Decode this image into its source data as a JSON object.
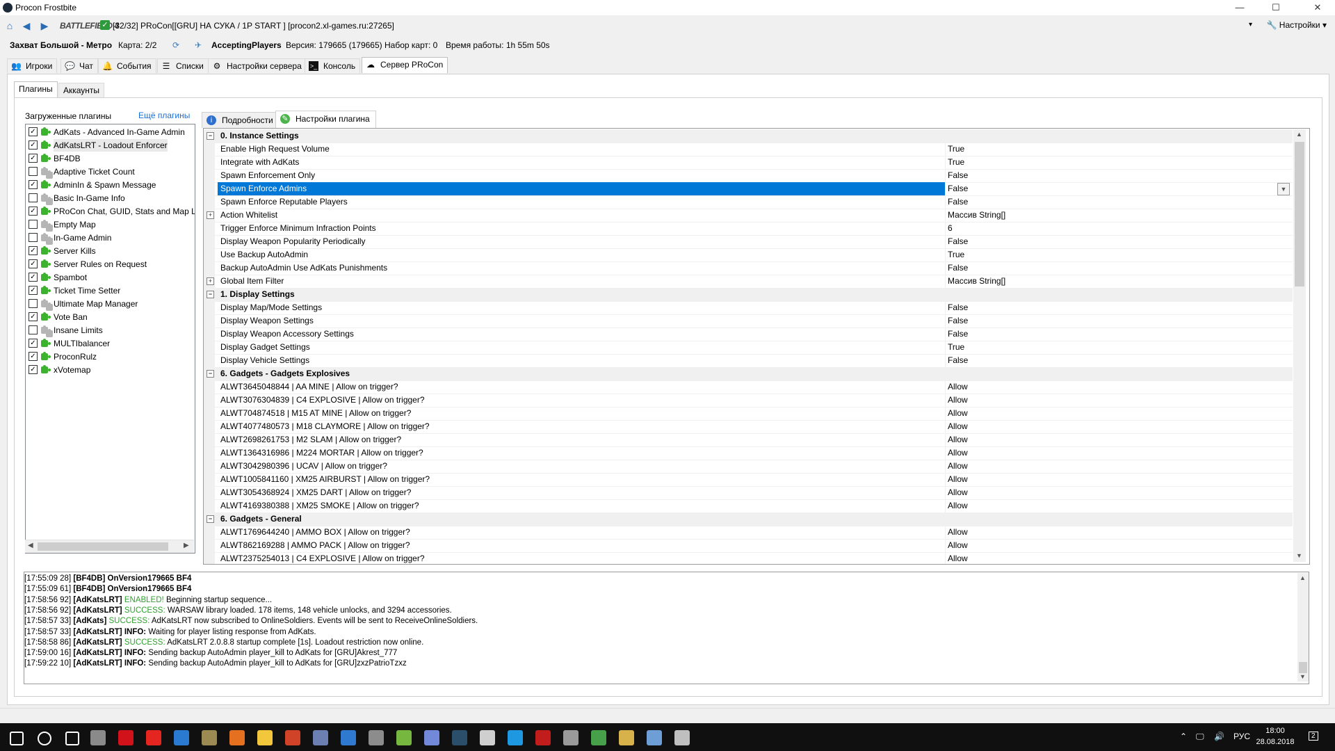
{
  "window": {
    "title": "Procon Frostbite",
    "minimize": "—",
    "maximize": "☐",
    "close": "✕"
  },
  "server": {
    "game": "BATTLEFIELD 4",
    "name": "[32/32] PRoCon[[GRU] НА СУКА / 1P START ] [procon2.xl-games.ru:27265]",
    "settings_label": "Настройки",
    "map": "Захват Большой - Метро",
    "maps": "Карта: 2/2",
    "state": "AcceptingPlayers",
    "version": "Версия: 179665 (179665)",
    "mapset": "Набор карт: 0",
    "uptime": "Время работы: 1h 55m 50s"
  },
  "main_tabs": [
    {
      "label": "Игроки",
      "icon": "players-icon"
    },
    {
      "label": "Чат",
      "icon": "chat-icon"
    },
    {
      "label": "События",
      "icon": "events-icon"
    },
    {
      "label": "Списки",
      "icon": "lists-icon"
    },
    {
      "label": "Настройки сервера",
      "icon": "server-settings-icon"
    },
    {
      "label": "Консоль",
      "icon": "console-icon"
    },
    {
      "label": "Сервер PRoCon",
      "icon": "procon-server-icon"
    }
  ],
  "sub_tabs": [
    {
      "label": "Плагины"
    },
    {
      "label": "Аккаунты"
    }
  ],
  "plugins_header": "Загруженные плагины",
  "more_plugins": "Ещё плагины",
  "plugins": [
    {
      "name": "AdKats - Advanced In-Game Admin",
      "enabled": true
    },
    {
      "name": "AdKatsLRT - Loadout Enforcer",
      "enabled": true
    },
    {
      "name": "BF4DB",
      "enabled": true
    },
    {
      "name": "Adaptive Ticket Count",
      "enabled": false
    },
    {
      "name": "AdminIn & Spawn Message",
      "enabled": true
    },
    {
      "name": "Basic In-Game Info",
      "enabled": false
    },
    {
      "name": "PRoCon Chat, GUID, Stats and Map Lo",
      "enabled": true
    },
    {
      "name": "Empty Map",
      "enabled": false
    },
    {
      "name": "In-Game Admin",
      "enabled": false
    },
    {
      "name": "Server Kills",
      "enabled": true
    },
    {
      "name": "Server Rules on Request",
      "enabled": true
    },
    {
      "name": "Spambot",
      "enabled": true
    },
    {
      "name": "Ticket Time Setter",
      "enabled": true
    },
    {
      "name": "Ultimate Map Manager",
      "enabled": false
    },
    {
      "name": "Vote Ban",
      "enabled": true
    },
    {
      "name": "Insane Limits",
      "enabled": false
    },
    {
      "name": "MULTIbalancer",
      "enabled": true
    },
    {
      "name": "ProconRulz",
      "enabled": true
    },
    {
      "name": "xVotemap",
      "enabled": true
    }
  ],
  "plugin_tabs": [
    {
      "label": "Подробности"
    },
    {
      "label": "Настройки плагина"
    }
  ],
  "settings": [
    {
      "cat": true,
      "name": "0. Instance Settings"
    },
    {
      "name": "Enable High Request Volume",
      "value": "True"
    },
    {
      "name": "Integrate with AdKats",
      "value": "True"
    },
    {
      "name": "Spawn Enforcement Only",
      "value": "False"
    },
    {
      "name": "Spawn Enforce Admins",
      "value": "False",
      "selected": true
    },
    {
      "name": "Spawn Enforce Reputable Players",
      "value": "False"
    },
    {
      "name": "Action Whitelist",
      "value": "Массив String[]",
      "expand": true
    },
    {
      "name": "Trigger Enforce Minimum Infraction Points",
      "value": "6"
    },
    {
      "name": "Display Weapon Popularity Periodically",
      "value": "False"
    },
    {
      "name": "Use Backup AutoAdmin",
      "value": "True"
    },
    {
      "name": "Backup AutoAdmin Use AdKats Punishments",
      "value": "False"
    },
    {
      "name": "Global Item Filter",
      "value": "Массив String[]",
      "expand": true
    },
    {
      "cat": true,
      "name": "1. Display Settings"
    },
    {
      "name": "Display Map/Mode Settings",
      "value": "False"
    },
    {
      "name": "Display Weapon Settings",
      "value": "False"
    },
    {
      "name": "Display Weapon Accessory Settings",
      "value": "False"
    },
    {
      "name": "Display Gadget Settings",
      "value": "True"
    },
    {
      "name": "Display Vehicle Settings",
      "value": "False"
    },
    {
      "cat": true,
      "name": "6. Gadgets - Gadgets Explosives"
    },
    {
      "name": "ALWT3645048844 | AA MINE | Allow on trigger?",
      "value": "Allow"
    },
    {
      "name": "ALWT3076304839 | C4 EXPLOSIVE | Allow on trigger?",
      "value": "Allow"
    },
    {
      "name": "ALWT704874518 | M15 AT MINE | Allow on trigger?",
      "value": "Allow"
    },
    {
      "name": "ALWT4077480573 | M18 CLAYMORE | Allow on trigger?",
      "value": "Allow"
    },
    {
      "name": "ALWT2698261753 | M2 SLAM | Allow on trigger?",
      "value": "Allow"
    },
    {
      "name": "ALWT1364316986 | M224 MORTAR | Allow on trigger?",
      "value": "Allow"
    },
    {
      "name": "ALWT3042980396 | UCAV | Allow on trigger?",
      "value": "Allow"
    },
    {
      "name": "ALWT1005841160 | XM25 AIRBURST | Allow on trigger?",
      "value": "Allow"
    },
    {
      "name": "ALWT3054368924 | XM25 DART | Allow on trigger?",
      "value": "Allow"
    },
    {
      "name": "ALWT4169380388 | XM25 SMOKE | Allow on trigger?",
      "value": "Allow"
    },
    {
      "cat": true,
      "name": "6. Gadgets - General"
    },
    {
      "name": "ALWT1769644240 | AMMO BOX | Allow on trigger?",
      "value": "Allow"
    },
    {
      "name": "ALWT862169288 | AMMO PACK | Allow on trigger?",
      "value": "Allow"
    },
    {
      "name": "ALWT2375254013 | C4 EXPLOSIVE | Allow on trigger?",
      "value": "Allow"
    }
  ],
  "log": [
    {
      "time": "[17:55:09 28]",
      "tag": "[BF4DB] OnVersion179665 BF4",
      "status": "",
      "msg": ""
    },
    {
      "time": "[17:55:09 61]",
      "tag": "[BF4DB] OnVersion179665 BF4",
      "status": "",
      "msg": ""
    },
    {
      "time": "[17:58:56 92]",
      "tag": "[AdKatsLRT]",
      "status": "ENABLED!",
      "msg": "Beginning startup sequence..."
    },
    {
      "time": "[17:58:56 92]",
      "tag": "[AdKatsLRT]",
      "status": "SUCCESS:",
      "msg": "WARSAW library loaded. 178 items, 148 vehicle unlocks, and 3294 accessories."
    },
    {
      "time": "[17:58:57 33]",
      "tag": "[AdKats]",
      "status": "SUCCESS:",
      "msg": "AdKatsLRT now subscribed to OnlineSoldiers. Events will be sent to ReceiveOnlineSoldiers."
    },
    {
      "time": "[17:58:57 33]",
      "tag": "[AdKatsLRT] INFO:",
      "status": "",
      "msg": "Waiting for player listing response from AdKats."
    },
    {
      "time": "[17:58:58 86]",
      "tag": "[AdKatsLRT]",
      "status": "SUCCESS:",
      "msg": "AdKatsLRT 2.0.8.8 startup complete [1s]. Loadout restriction now online."
    },
    {
      "time": "[17:59:00 16]",
      "tag": "[AdKatsLRT] INFO:",
      "status": "",
      "msg": "Sending backup AutoAdmin player_kill to AdKats for [GRU]Akrest_777"
    },
    {
      "time": "[17:59:22 10]",
      "tag": "[AdKatsLRT] INFO:",
      "status": "",
      "msg": "Sending backup AutoAdmin player_kill to AdKats for [GRU]zxzPatrioTzxz"
    }
  ],
  "taskbar": {
    "lang": "РУС",
    "time": "18:00",
    "date": "28.08.2018",
    "notifications": "2",
    "tray_up": "⌃",
    "tray_net": "🖵",
    "tray_sound": "🔊",
    "taskbar_icons": [
      "windows-start-icon",
      "search-icon",
      "task-view-icon",
      "app-icon",
      "opera-icon",
      "yandex-icon",
      "edge-icon",
      "app-icon",
      "app-icon",
      "explorer-icon",
      "app-icon",
      "app-icon",
      "app-icon",
      "app-icon",
      "utorrent-icon",
      "discord-icon",
      "procon-icon",
      "app-icon",
      "app-icon",
      "app-icon",
      "gamepad-icon",
      "app-icon",
      "app-icon",
      "app-icon",
      "app-icon"
    ],
    "taskbar_colors": [
      "#ffffff",
      "#ffffff",
      "#ffffff",
      "#8a8a8a",
      "#d1121b",
      "#e52620",
      "#2a7ad2",
      "#9b8a52",
      "#e5701f",
      "#f2c73b",
      "#d04328",
      "#6b7fb0",
      "#2f7ad0",
      "#8c8c8c",
      "#76b83f",
      "#7289da",
      "#2b4f6b",
      "#cfcfcf",
      "#1e98e0",
      "#c21d1d",
      "#9a9a9a",
      "#47a04a",
      "#d7b24b",
      "#6e9ed6",
      "#bfbfbf"
    ]
  }
}
